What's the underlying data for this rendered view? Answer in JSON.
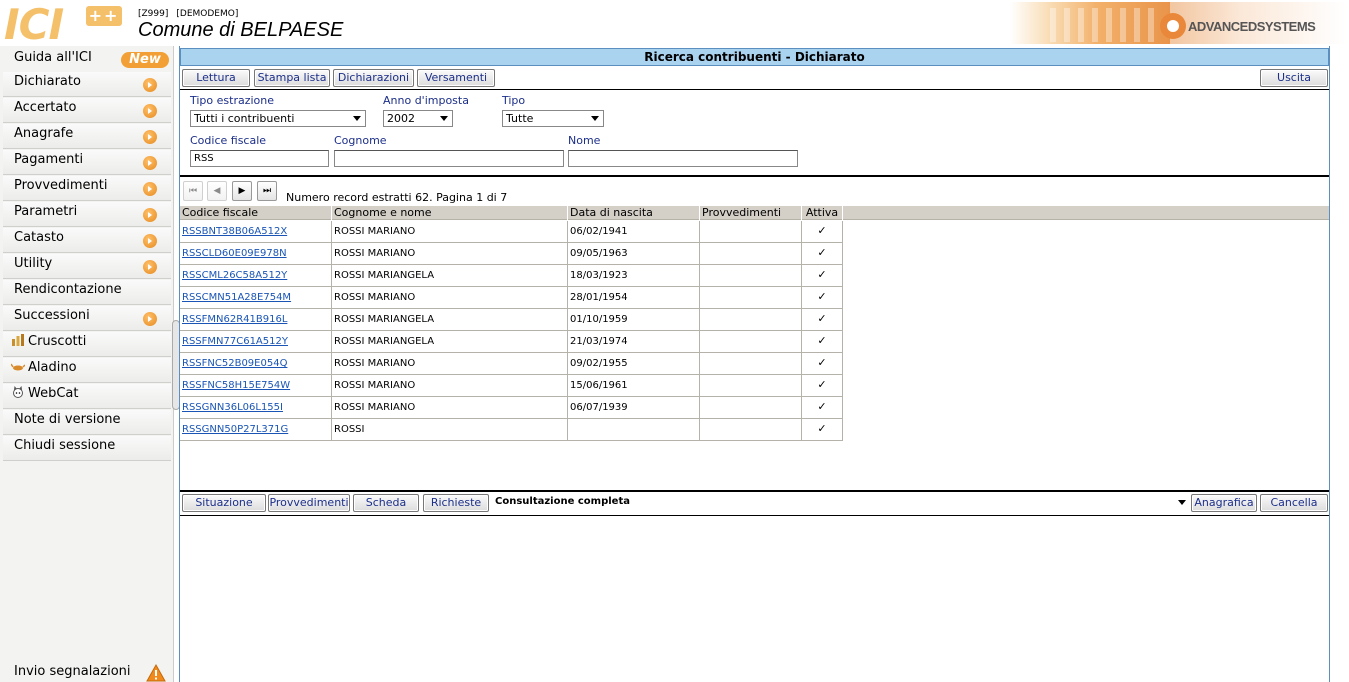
{
  "header": {
    "code": "[Z999]",
    "user": "[DEMODEMO]",
    "comune": "Comune di BELPAESE",
    "app_logo_text": "ICI",
    "app_logo_plus": "++",
    "vendor_logo": "ADVANCEDSYSTEMS"
  },
  "sidebar": {
    "guida": "Guida all'ICI",
    "new_badge": "New",
    "items": [
      {
        "label": "Dichiarato"
      },
      {
        "label": "Accertato"
      },
      {
        "label": "Anagrafe"
      },
      {
        "label": "Pagamenti"
      },
      {
        "label": "Provvedimenti"
      },
      {
        "label": "Parametri"
      },
      {
        "label": "Catasto"
      },
      {
        "label": "Utility"
      },
      {
        "label": "Rendicontazione"
      },
      {
        "label": "Successioni"
      },
      {
        "label": "Cruscotti",
        "icon": "chart-icon"
      },
      {
        "label": "Aladino",
        "icon": "lamp-icon"
      },
      {
        "label": "WebCat",
        "icon": "cat-icon"
      },
      {
        "label": "Note di versione"
      },
      {
        "label": "Chiudi sessione"
      }
    ],
    "invio": "Invio segnalazioni"
  },
  "main": {
    "title": "Ricerca contribuenti - Dichiarato",
    "toolbar": {
      "lettura": "Lettura",
      "stampa": "Stampa lista",
      "dichiarazioni": "Dichiarazioni",
      "versamenti": "Versamenti",
      "uscita": "Uscita"
    },
    "form": {
      "tipo_estrazione_label": "Tipo estrazione",
      "tipo_estrazione_value": "Tutti i contribuenti",
      "anno_label": "Anno d'imposta",
      "anno_value": "2002",
      "tipo_label": "Tipo",
      "tipo_value": "Tutte",
      "codice_fiscale_label": "Codice fiscale",
      "codice_fiscale_value": "RSS",
      "cognome_label": "Cognome",
      "cognome_value": "",
      "nome_label": "Nome",
      "nome_value": ""
    },
    "pager": {
      "info": "Numero record estratti 62. Pagina 1 di 7"
    },
    "grid": {
      "headers": [
        "Codice fiscale",
        "Cognome e nome",
        "Data di nascita",
        "Provvedimenti",
        "Attiva"
      ],
      "rows": [
        {
          "cf": "RSSBNT38B06A512X",
          "name": "ROSSI MARIANO",
          "birth": "06/02/1941",
          "provv": "",
          "active": "✓"
        },
        {
          "cf": "RSSCLD60E09E978N",
          "name": "ROSSI MARIANO",
          "birth": "09/05/1963",
          "provv": "",
          "active": "✓"
        },
        {
          "cf": "RSSCML26C58A512Y",
          "name": "ROSSI MARIANGELA",
          "birth": "18/03/1923",
          "provv": "",
          "active": "✓"
        },
        {
          "cf": "RSSCMN51A28E754M",
          "name": "ROSSI MARIANO",
          "birth": "28/01/1954",
          "provv": "",
          "active": "✓"
        },
        {
          "cf": "RSSFMN62R41B916L",
          "name": "ROSSI MARIANGELA",
          "birth": "01/10/1959",
          "provv": "",
          "active": "✓"
        },
        {
          "cf": "RSSFMN77C61A512Y",
          "name": "ROSSI MARIANGELA",
          "birth": "21/03/1974",
          "provv": "",
          "active": "✓"
        },
        {
          "cf": "RSSFNC52B09E054Q",
          "name": "ROSSI MARIANO",
          "birth": "09/02/1955",
          "provv": "",
          "active": "✓"
        },
        {
          "cf": "RSSFNC58H15E754W",
          "name": "ROSSI MARIANO",
          "birth": "15/06/1961",
          "provv": "",
          "active": "✓"
        },
        {
          "cf": "RSSGNN36L06L155I",
          "name": "ROSSI MARIANO",
          "birth": "06/07/1939",
          "provv": "",
          "active": "✓"
        },
        {
          "cf": "RSSGNN50P27L371G",
          "name": "ROSSI",
          "birth": "",
          "provv": "",
          "active": "✓"
        }
      ]
    },
    "bottom": {
      "situazione": "Situazione",
      "provvedimenti": "Provvedimenti",
      "scheda": "Scheda",
      "richieste": "Richieste",
      "consultazione": "Consultazione completa",
      "anagrafica": "Anagrafica",
      "cancella": "Cancella"
    }
  }
}
